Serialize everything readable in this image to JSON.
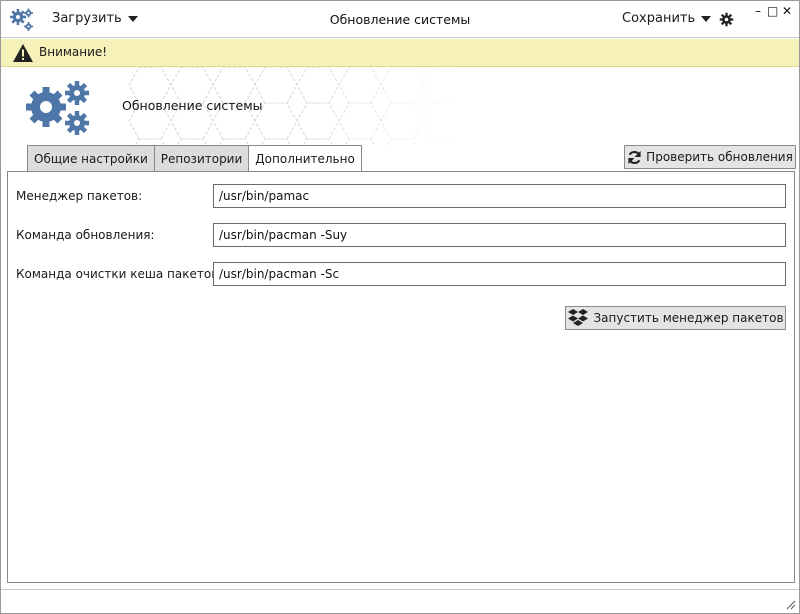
{
  "titlebar": {
    "load_label": "Загрузить",
    "title": "Обновление системы",
    "save_label": "Сохранить",
    "minimize_glyph": "–",
    "maximize_glyph": "□",
    "close_glyph": "✕"
  },
  "alert": {
    "text": "Внимание!",
    "icon": "warning-icon"
  },
  "header": {
    "title": "Обновление системы",
    "icon": "gears-icon"
  },
  "tabs": [
    {
      "label": "Общие настройки",
      "active": false
    },
    {
      "label": "Репозитории",
      "active": false
    },
    {
      "label": "Дополнительно",
      "active": true
    }
  ],
  "check_updates_label": "Проверить обновления",
  "fields": [
    {
      "label": "Менеджер пакетов:",
      "value": "/usr/bin/pamac"
    },
    {
      "label": "Команда обновления:",
      "value": "/usr/bin/pacman -Suy"
    },
    {
      "label": "Команда очистки кеша пакетов:",
      "value": "/usr/bin/pacman -Sc"
    }
  ],
  "run_manager_label": "Запустить менеджер пакетов",
  "colors": {
    "accent_blue": "#4f76a8",
    "alert_bg": "#f6f1b8"
  }
}
